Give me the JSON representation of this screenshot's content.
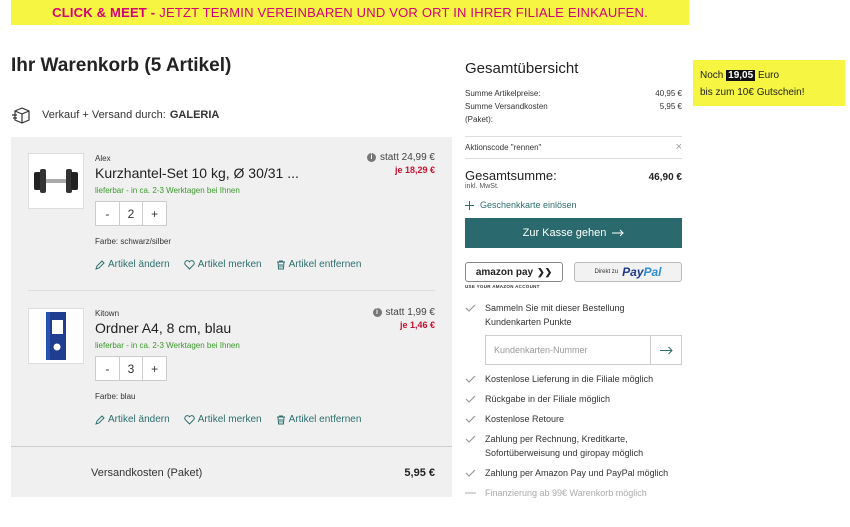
{
  "banner": {
    "strong": "Click & Meet -",
    "rest": "Jetzt Termin vereinbaren und vor Ort in Ihrer Filiale einkaufen."
  },
  "page": {
    "title": "Ihr Warenkorb (5 Artikel)"
  },
  "seller": {
    "prefix": "Verkauf + Versand durch:",
    "name": "GALERIA"
  },
  "items": [
    {
      "brand": "Alex",
      "name": "Kurzhantel-Set 10 kg, Ø 30/31 ...",
      "availability": "lieferbar - in ca. 2-3 Werktagen bei Ihnen",
      "qty_minus": "-",
      "quantity": "2",
      "qty_plus": "+",
      "color": "Farbe: schwarz/silber",
      "price_old": "statt 24,99 €",
      "price_new": "je 18,29 €",
      "edit_label": "Artikel ändern",
      "wishlist_label": "Artikel merken",
      "remove_label": "Artikel entfernen"
    },
    {
      "brand": "Kitown",
      "name": "Ordner A4, 8 cm, blau",
      "availability": "lieferbar - in ca. 2-3 Werktagen bei Ihnen",
      "qty_minus": "-",
      "quantity": "3",
      "qty_plus": "+",
      "color": "Farbe: blau",
      "price_old": "statt 1,99 €",
      "price_new": "je 1,46 €",
      "edit_label": "Artikel ändern",
      "wishlist_label": "Artikel merken",
      "remove_label": "Artikel entfernen"
    }
  ],
  "shipping": {
    "label": "Versandkosten (Paket)",
    "value": "5,95 €"
  },
  "summary": {
    "title": "Gesamtübersicht",
    "items_label": "Summe Artikelpreise:",
    "items_value": "40,95 €",
    "shipping_label": "Summe Versandkosten",
    "shipping_label2": "(Paket):",
    "shipping_value": "5,95 €",
    "promo_label": "Aktionscode \"rennen\"",
    "promo_close": "×",
    "total_label": "Gesamtsumme:",
    "total_value": "46,90 €",
    "vat": "inkl. MwSt.",
    "gift_label": "Geschenkkarte einlösen",
    "checkout_label": "Zur Kasse gehen",
    "amazon_label": "amazon pay",
    "amazon_sub": "USE YOUR AMAZON ACCOUNT",
    "paypal_prefix": "Direkt zu",
    "paypal_pay": "Pay",
    "paypal_pal": "Pal",
    "loyalty_text": "Sammeln Sie mit dieser Bestellung Kundenkarten Punkte",
    "card_placeholder": "Kundenkarten-Nummer",
    "benefits": [
      "Kostenlose Lieferung in die Filiale möglich",
      "Rückgabe in der Filiale möglich",
      "Kostenlose Retoure",
      "Zahlung per Rechnung, Kreditkarte, Sofortüberweisung und giropay möglich",
      "Zahlung per Amazon Pay und PayPal möglich"
    ],
    "financing": "Finanzierung ab 99€ Warenkorb möglich"
  },
  "promo_box": {
    "prefix": "Noch",
    "amount": "19,05",
    "suffix": "Euro",
    "line2": "bis zum 10€ Gutschein!"
  },
  "colors": {
    "banner_bg": "#f5f542",
    "banner_text": "#d6007a",
    "accent": "#2a6a6e",
    "price_red": "#c8102e",
    "availability": "#3a9a2a"
  }
}
